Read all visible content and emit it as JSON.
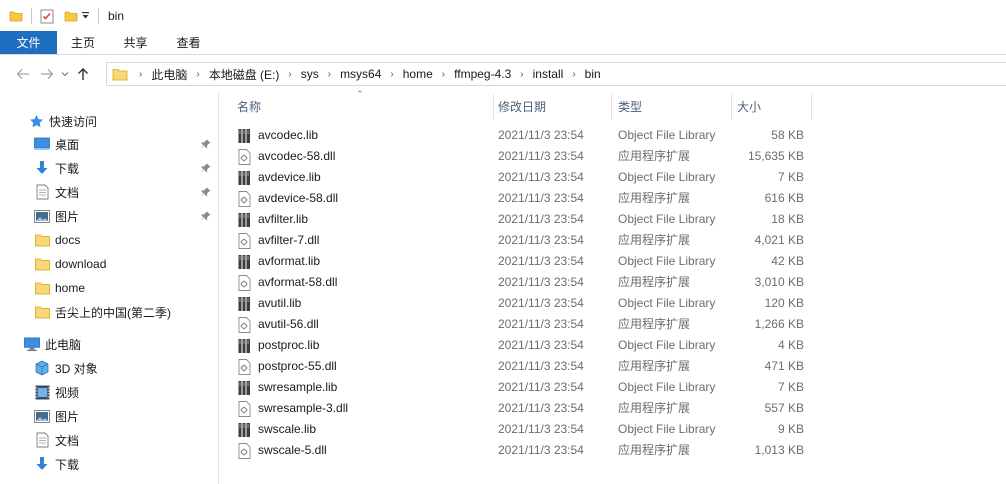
{
  "window": {
    "title": "bin"
  },
  "ribbon": {
    "tabs": [
      "文件",
      "主页",
      "共享",
      "查看"
    ]
  },
  "address": {
    "crumbs": [
      "此电脑",
      "本地磁盘 (E:)",
      "sys",
      "msys64",
      "home",
      "ffmpeg-4.3",
      "install",
      "bin"
    ]
  },
  "sidebar": {
    "quick_access": "快速访问",
    "quick_items": [
      {
        "label": "桌面",
        "icon": "desktop-icon",
        "pinned": true
      },
      {
        "label": "下载",
        "icon": "download-arrow-icon",
        "pinned": true
      },
      {
        "label": "文档",
        "icon": "document-icon",
        "pinned": true
      },
      {
        "label": "图片",
        "icon": "picture-icon",
        "pinned": true
      },
      {
        "label": "docs",
        "icon": "folder-icon"
      },
      {
        "label": "download",
        "icon": "folder-icon"
      },
      {
        "label": "home",
        "icon": "folder-icon"
      },
      {
        "label": "舌尖上的中国(第二季)",
        "icon": "folder-icon"
      }
    ],
    "this_pc": "此电脑",
    "pc_items": [
      {
        "label": "3D 对象",
        "icon": "3d-objects-icon"
      },
      {
        "label": "视频",
        "icon": "video-icon"
      },
      {
        "label": "图片",
        "icon": "picture-icon"
      },
      {
        "label": "文档",
        "icon": "document-icon"
      },
      {
        "label": "下载",
        "icon": "download-arrow-icon"
      }
    ]
  },
  "columns": {
    "name": "名称",
    "date": "修改日期",
    "type": "类型",
    "size": "大小"
  },
  "files": [
    {
      "name": "avcodec.lib",
      "date": "2021/11/3 23:54",
      "type": "Object File Library",
      "size": "58 KB",
      "kind": "lib"
    },
    {
      "name": "avcodec-58.dll",
      "date": "2021/11/3 23:54",
      "type": "应用程序扩展",
      "size": "15,635 KB",
      "kind": "dll"
    },
    {
      "name": "avdevice.lib",
      "date": "2021/11/3 23:54",
      "type": "Object File Library",
      "size": "7 KB",
      "kind": "lib"
    },
    {
      "name": "avdevice-58.dll",
      "date": "2021/11/3 23:54",
      "type": "应用程序扩展",
      "size": "616 KB",
      "kind": "dll"
    },
    {
      "name": "avfilter.lib",
      "date": "2021/11/3 23:54",
      "type": "Object File Library",
      "size": "18 KB",
      "kind": "lib"
    },
    {
      "name": "avfilter-7.dll",
      "date": "2021/11/3 23:54",
      "type": "应用程序扩展",
      "size": "4,021 KB",
      "kind": "dll"
    },
    {
      "name": "avformat.lib",
      "date": "2021/11/3 23:54",
      "type": "Object File Library",
      "size": "42 KB",
      "kind": "lib"
    },
    {
      "name": "avformat-58.dll",
      "date": "2021/11/3 23:54",
      "type": "应用程序扩展",
      "size": "3,010 KB",
      "kind": "dll"
    },
    {
      "name": "avutil.lib",
      "date": "2021/11/3 23:54",
      "type": "Object File Library",
      "size": "120 KB",
      "kind": "lib"
    },
    {
      "name": "avutil-56.dll",
      "date": "2021/11/3 23:54",
      "type": "应用程序扩展",
      "size": "1,266 KB",
      "kind": "dll"
    },
    {
      "name": "postproc.lib",
      "date": "2021/11/3 23:54",
      "type": "Object File Library",
      "size": "4 KB",
      "kind": "lib"
    },
    {
      "name": "postproc-55.dll",
      "date": "2021/11/3 23:54",
      "type": "应用程序扩展",
      "size": "471 KB",
      "kind": "dll"
    },
    {
      "name": "swresample.lib",
      "date": "2021/11/3 23:54",
      "type": "Object File Library",
      "size": "7 KB",
      "kind": "lib"
    },
    {
      "name": "swresample-3.dll",
      "date": "2021/11/3 23:54",
      "type": "应用程序扩展",
      "size": "557 KB",
      "kind": "dll"
    },
    {
      "name": "swscale.lib",
      "date": "2021/11/3 23:54",
      "type": "Object File Library",
      "size": "9 KB",
      "kind": "lib"
    },
    {
      "name": "swscale-5.dll",
      "date": "2021/11/3 23:54",
      "type": "应用程序扩展",
      "size": "1,013 KB",
      "kind": "dll"
    }
  ]
}
